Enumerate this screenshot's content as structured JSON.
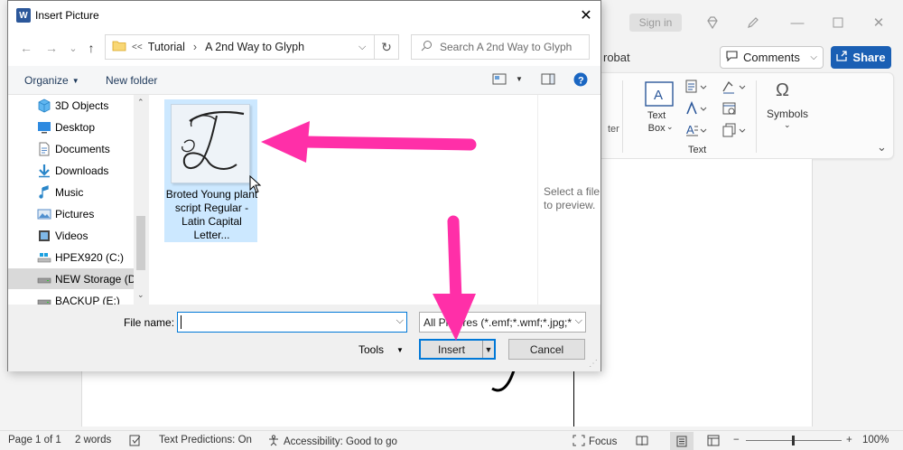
{
  "word": {
    "signin_label": "Sign in",
    "acrobat_tab": "robat",
    "comments_label": "Comments",
    "share_label": "Share",
    "ribbon": {
      "text_box_label": "Text\nBox",
      "text_group": "Text",
      "symbols_label": "Symbols",
      "left_clip_label": "ter"
    },
    "status": {
      "page": "Page 1 of 1",
      "words": "2 words",
      "predictions": "Text Predictions: On",
      "accessibility": "Accessibility: Good to go",
      "focus": "Focus",
      "zoom": "100%"
    }
  },
  "dialog": {
    "title": "Insert Picture",
    "path": {
      "overflow": "<<",
      "segments": [
        "Tutorial",
        "A 2nd Way to Glyph"
      ]
    },
    "search_placeholder": "Search A 2nd Way to Glyph",
    "toolbar": {
      "organize": "Organize",
      "new_folder": "New folder"
    },
    "sidebar": [
      {
        "label": "3D Objects",
        "icon": "cube-icon"
      },
      {
        "label": "Desktop",
        "icon": "desktop-icon"
      },
      {
        "label": "Documents",
        "icon": "documents-icon"
      },
      {
        "label": "Downloads",
        "icon": "download-icon"
      },
      {
        "label": "Music",
        "icon": "music-icon"
      },
      {
        "label": "Pictures",
        "icon": "pictures-icon"
      },
      {
        "label": "Videos",
        "icon": "videos-icon"
      },
      {
        "label": "HPEX920 (C:)",
        "icon": "drive-icon"
      },
      {
        "label": "NEW Storage (D:",
        "icon": "drive-icon",
        "selected": true
      },
      {
        "label": "BACKUP (E:)",
        "icon": "drive-icon"
      }
    ],
    "file": {
      "label": "Broted Young plant script Regular - Latin Capital Letter...",
      "glyph": "T"
    },
    "preview_text": "Select a file to preview.",
    "filename_label": "File name:",
    "filename_value": "",
    "filter": "All Pictures (*.emf;*.wmf;*.jpg;*",
    "tools_label": "Tools",
    "insert_label": "Insert",
    "cancel_label": "Cancel"
  },
  "colors": {
    "accent": "#0078d7",
    "share": "#1a5fb4",
    "arrow": "#ff2fa8",
    "selection": "#cce8ff"
  }
}
